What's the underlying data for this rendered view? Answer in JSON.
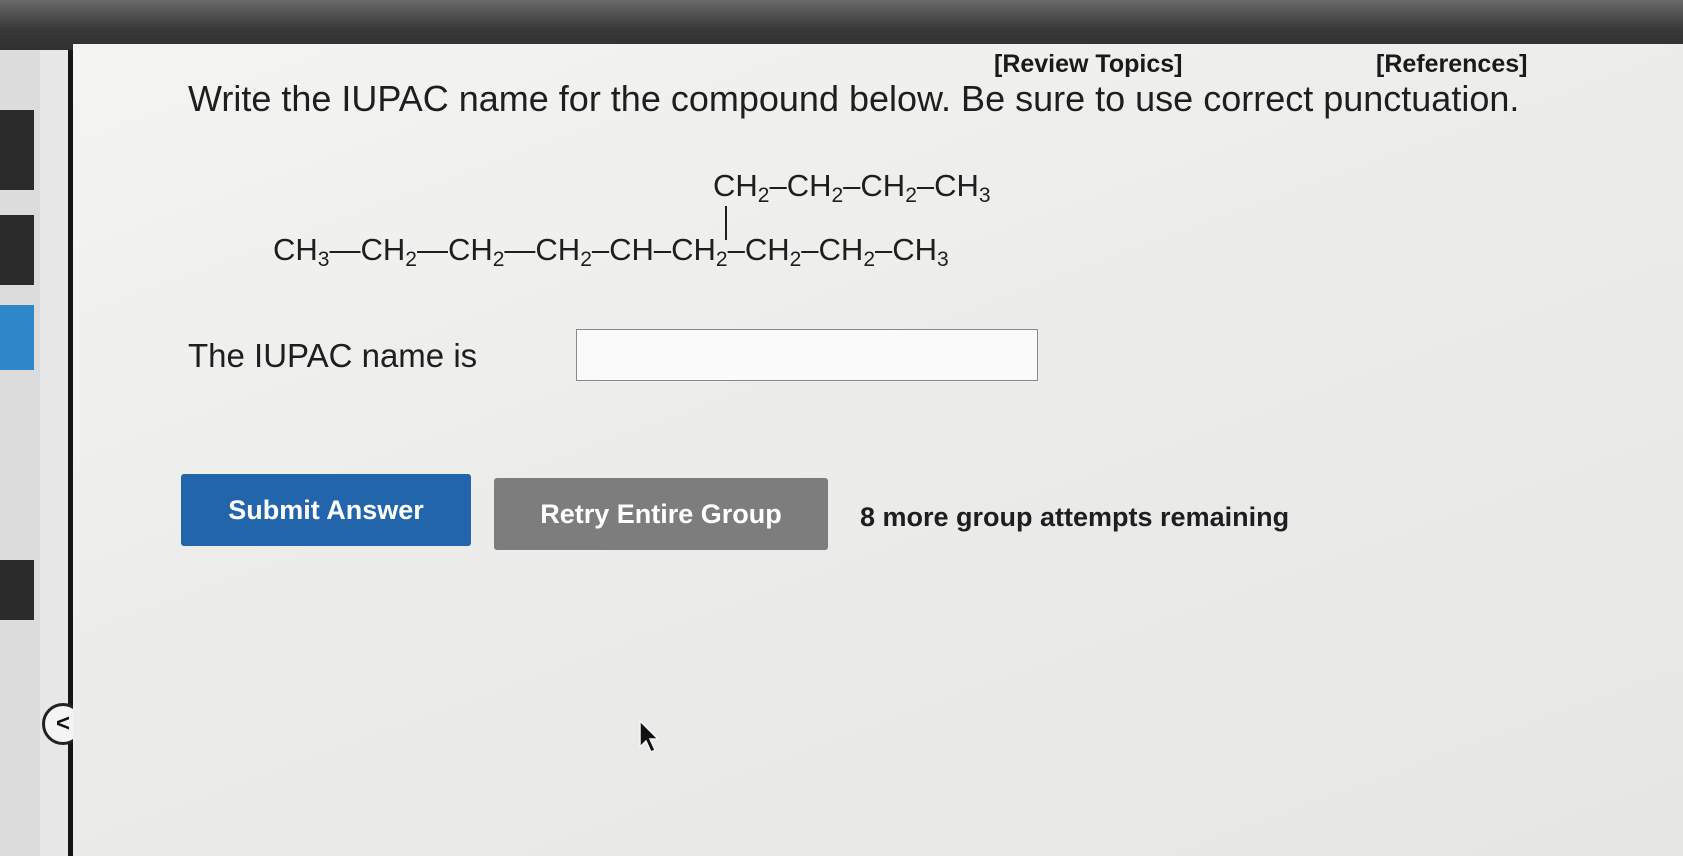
{
  "header": {
    "review_topics": "[Review Topics]",
    "references": "[References]"
  },
  "question": {
    "prompt": "Write the IUPAC name for the compound below. Be sure to use correct punctuation."
  },
  "structure": {
    "branch": [
      "CH",
      "2",
      "–CH",
      "2",
      "–CH",
      "2",
      "–CH",
      "3"
    ],
    "main_chain": [
      "CH",
      "3",
      "—CH",
      "2",
      "—CH",
      "2",
      "—CH",
      "2",
      "–CH–CH",
      "2",
      "–CH",
      "2",
      "–CH",
      "2",
      "–CH",
      "3"
    ]
  },
  "answer": {
    "label": "The IUPAC name is",
    "value": "",
    "placeholder": ""
  },
  "actions": {
    "submit_label": "Submit Answer",
    "retry_label": "Retry Entire Group",
    "attempts_text": "8 more group attempts remaining"
  },
  "sidebar": {
    "back_label": "<"
  },
  "colors": {
    "submit": "#2365ab",
    "retry": "#7d7d7d",
    "accent_strip": "#2f86c8"
  }
}
